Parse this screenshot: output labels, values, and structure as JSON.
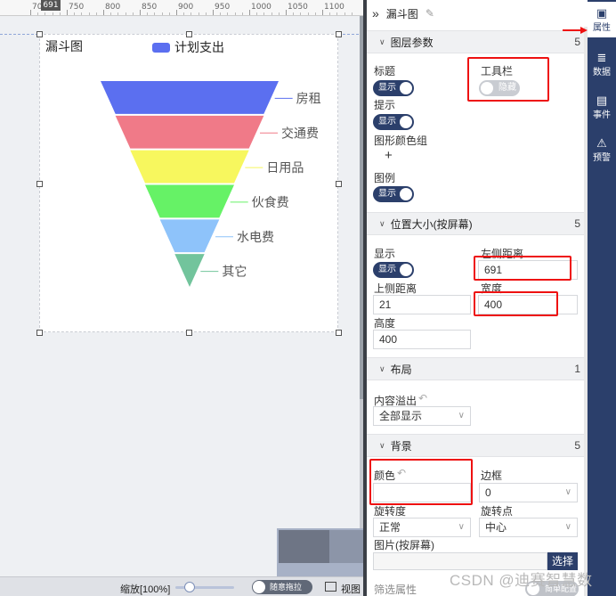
{
  "ruler": {
    "labels": [
      "700",
      "750",
      "800",
      "850",
      "900",
      "950",
      "1000",
      "1050",
      "1100"
    ],
    "marker": "691"
  },
  "chart": {
    "title": "漏斗图",
    "legend": "计划支出",
    "label_color": "#555555"
  },
  "chart_data": {
    "type": "funnel",
    "title": "漏斗图",
    "series": [
      {
        "name": "计划支出",
        "color": "#5b6ff0"
      }
    ],
    "categories": [
      "房租",
      "交通费",
      "日用品",
      "伙食费",
      "水电费",
      "其它"
    ],
    "values": [
      6,
      5,
      4,
      3,
      2,
      1
    ],
    "colors": [
      "#5b6ff0",
      "#f07a88",
      "#f7f75e",
      "#66f266",
      "#8ec3fa",
      "#72c49c"
    ],
    "legend_position": "top"
  },
  "zoom": {
    "label": "缩放[100%]",
    "value_percent": 100,
    "drag_label": "随意拖拉",
    "view_label": "视图"
  },
  "panel": {
    "title": "漏斗图",
    "sections": [
      {
        "title": "图层参数",
        "count": "5"
      },
      {
        "title": "位置大小(按屏幕)",
        "count": "5"
      },
      {
        "title": "布局",
        "count": "1"
      },
      {
        "title": "背景",
        "count": "5"
      }
    ],
    "layer": {
      "title_label": "标题",
      "title_toggle": "显示",
      "toolbar_label": "工具栏",
      "toolbar_toggle": "隐藏",
      "tooltip_label": "提示",
      "tooltip_toggle": "显示",
      "color_group_label": "图形颜色组",
      "add_symbol": "+",
      "legend_label": "图例",
      "legend_toggle": "显示"
    },
    "position": {
      "show_label": "显示",
      "show_toggle": "显示",
      "left_label": "左侧距离",
      "left_value": "691",
      "top_label": "上侧距离",
      "top_value": "21",
      "width_label": "宽度",
      "width_value": "400",
      "height_label": "高度",
      "height_value": "400"
    },
    "layout": {
      "overflow_label": "内容溢出",
      "overflow_value": "全部显示"
    },
    "background": {
      "color_label": "颜色",
      "color_value": "",
      "border_label": "边框",
      "border_value": "0",
      "rotate_label": "旋转度",
      "rotate_value": "正常",
      "pivot_label": "旋转点",
      "pivot_value": "中心",
      "image_label": "图片(按屏幕)",
      "choose_label": "选择",
      "filter_label": "筛选属性",
      "filter_toggle": "简单配置"
    }
  },
  "sidebar": {
    "items": [
      {
        "label": "属性",
        "icon": "properties-icon"
      },
      {
        "label": "数据",
        "icon": "database-icon"
      },
      {
        "label": "事件",
        "icon": "event-icon"
      },
      {
        "label": "预警",
        "icon": "alarm-icon"
      }
    ]
  },
  "watermark": "CSDN @迪赛智慧数"
}
